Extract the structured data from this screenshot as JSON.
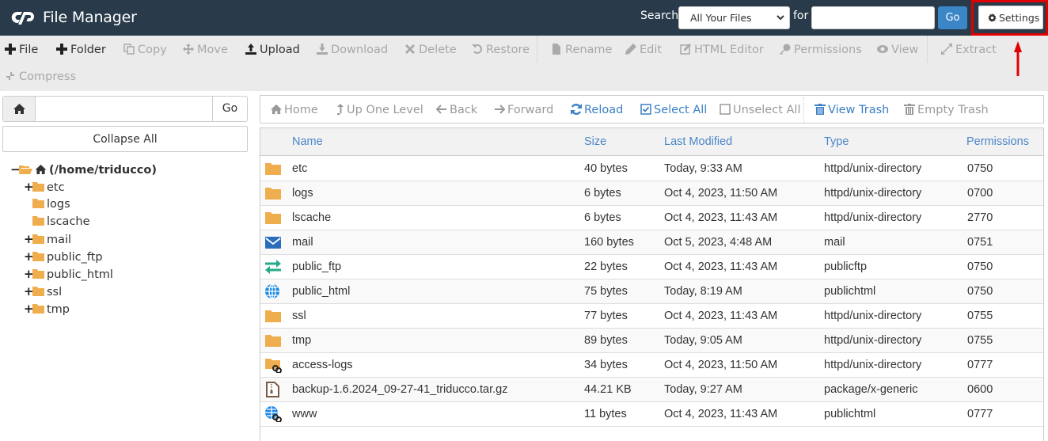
{
  "header": {
    "title": "File Manager",
    "logo": "cpanel-logo",
    "search_label": "Search",
    "search_scope": "All Your Files",
    "for_label": "for",
    "search_value": "",
    "go_label": "Go",
    "settings_label": "Settings",
    "annotation_color": "#e00000"
  },
  "toolbar": {
    "items": [
      {
        "label": "File",
        "icon": "plus-icon",
        "enabled": true
      },
      {
        "label": "Folder",
        "icon": "plus-icon",
        "enabled": true
      },
      {
        "label": "Copy",
        "icon": "copy-icon",
        "enabled": false
      },
      {
        "label": "Move",
        "icon": "move-icon",
        "enabled": false
      },
      {
        "label": "Upload",
        "icon": "upload-icon",
        "enabled": true
      },
      {
        "label": "Download",
        "icon": "download-icon",
        "enabled": false
      },
      {
        "label": "Delete",
        "icon": "delete-icon",
        "enabled": false
      },
      {
        "label": "Restore",
        "icon": "restore-icon",
        "enabled": false
      },
      {
        "label": "Rename",
        "icon": "rename-icon",
        "enabled": false
      },
      {
        "label": "Edit",
        "icon": "pencil-icon",
        "enabled": false
      },
      {
        "label": "HTML Editor",
        "icon": "html-editor-icon",
        "enabled": false
      },
      {
        "label": "Permissions",
        "icon": "key-icon",
        "enabled": false
      },
      {
        "label": "View",
        "icon": "eye-icon",
        "enabled": false
      },
      {
        "label": "Extract",
        "icon": "expand-icon",
        "enabled": false
      },
      {
        "label": "Compress",
        "icon": "compress-icon",
        "enabled": false
      }
    ]
  },
  "left_panel": {
    "path_value": "",
    "go_label": "Go",
    "collapse_all_label": "Collapse All",
    "tree": {
      "root": "(/home/triducco)",
      "children": [
        {
          "name": "etc",
          "expandable": true
        },
        {
          "name": "logs",
          "expandable": false
        },
        {
          "name": "lscache",
          "expandable": false
        },
        {
          "name": "mail",
          "expandable": true
        },
        {
          "name": "public_ftp",
          "expandable": true
        },
        {
          "name": "public_html",
          "expandable": true
        },
        {
          "name": "ssl",
          "expandable": true
        },
        {
          "name": "tmp",
          "expandable": true
        }
      ]
    }
  },
  "nav": {
    "items": [
      {
        "label": "Home",
        "active": false
      },
      {
        "label": "Up One Level",
        "active": false
      },
      {
        "label": "Back",
        "active": false
      },
      {
        "label": "Forward",
        "active": false
      },
      {
        "label": "Reload",
        "active": true
      },
      {
        "label": "Select All",
        "active": true
      },
      {
        "label": "Unselect All",
        "active": false
      },
      {
        "label": "View Trash",
        "active": true
      },
      {
        "label": "Empty Trash",
        "active": false
      }
    ]
  },
  "table": {
    "columns": [
      "Name",
      "Size",
      "Last Modified",
      "Type",
      "Permissions"
    ],
    "rows": [
      {
        "icon": "folder",
        "name": "etc",
        "size": "40 bytes",
        "modified": "Today, 9:33 AM",
        "type": "httpd/unix-directory",
        "perms": "0750"
      },
      {
        "icon": "folder",
        "name": "logs",
        "size": "6 bytes",
        "modified": "Oct 4, 2023, 11:50 AM",
        "type": "httpd/unix-directory",
        "perms": "0700"
      },
      {
        "icon": "folder",
        "name": "lscache",
        "size": "6 bytes",
        "modified": "Oct 4, 2023, 11:43 AM",
        "type": "httpd/unix-directory",
        "perms": "2770"
      },
      {
        "icon": "mail",
        "name": "mail",
        "size": "160 bytes",
        "modified": "Oct 5, 2023, 4:48 AM",
        "type": "mail",
        "perms": "0751"
      },
      {
        "icon": "ftp",
        "name": "public_ftp",
        "size": "22 bytes",
        "modified": "Oct 4, 2023, 11:43 AM",
        "type": "publicftp",
        "perms": "0750"
      },
      {
        "icon": "globe",
        "name": "public_html",
        "size": "75 bytes",
        "modified": "Today, 8:19 AM",
        "type": "publichtml",
        "perms": "0750"
      },
      {
        "icon": "folder",
        "name": "ssl",
        "size": "77 bytes",
        "modified": "Oct 4, 2023, 11:43 AM",
        "type": "httpd/unix-directory",
        "perms": "0755"
      },
      {
        "icon": "folder",
        "name": "tmp",
        "size": "89 bytes",
        "modified": "Today, 9:05 AM",
        "type": "httpd/unix-directory",
        "perms": "0755"
      },
      {
        "icon": "folder-link",
        "name": "access-logs",
        "size": "34 bytes",
        "modified": "Oct 4, 2023, 11:50 AM",
        "type": "httpd/unix-directory",
        "perms": "0777"
      },
      {
        "icon": "archive",
        "name": "backup-1.6.2024_09-27-41_triducco.tar.gz",
        "size": "44.21 KB",
        "modified": "Today, 9:27 AM",
        "type": "package/x-generic",
        "perms": "0600"
      },
      {
        "icon": "globe-link",
        "name": "www",
        "size": "11 bytes",
        "modified": "Oct 4, 2023, 11:43 AM",
        "type": "publichtml",
        "perms": "0777"
      }
    ]
  },
  "colors": {
    "header_bg": "#293a4a",
    "accent_blue": "#3b86c6",
    "link_blue": "#3b7fc4",
    "folder": "#f0ad4e",
    "mail": "#2a6ebb",
    "ftp": "#27a98a",
    "globe": "#1e88e5"
  }
}
